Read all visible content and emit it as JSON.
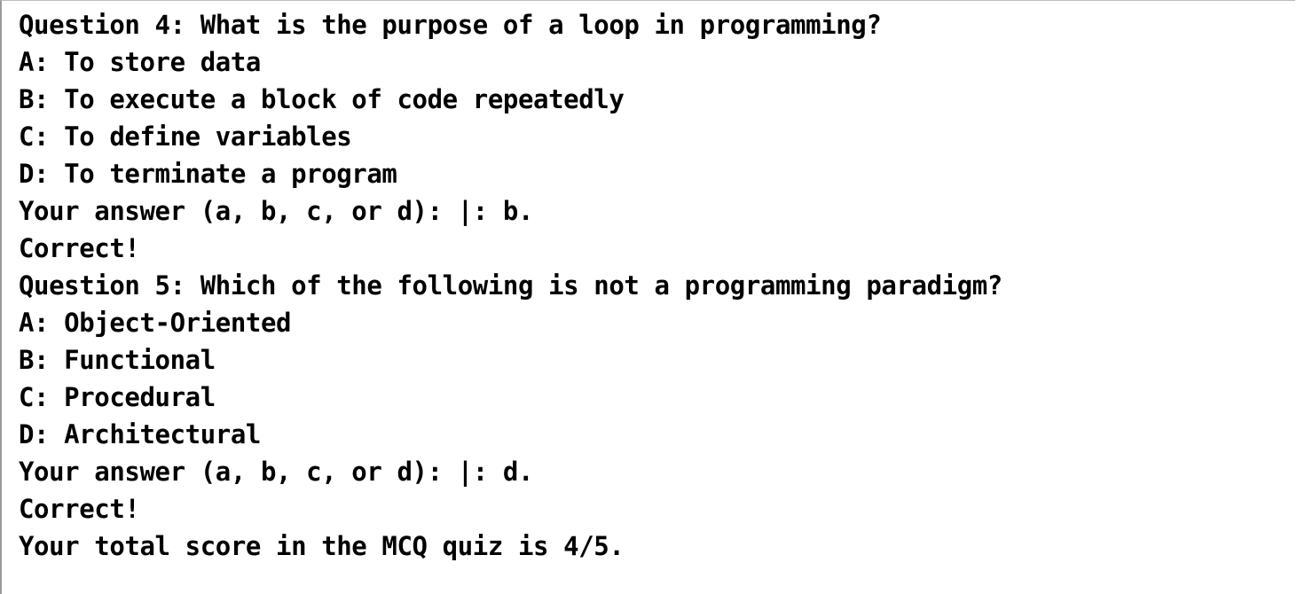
{
  "console": {
    "lines": [
      "Question 4: What is the purpose of a loop in programming?",
      "A: To store data",
      "B: To execute a block of code repeatedly",
      "C: To define variables",
      "D: To terminate a program",
      "Your answer (a, b, c, or d): |: b.",
      "Correct!",
      "Question 5: Which of the following is not a programming paradigm?",
      "A: Object-Oriented",
      "B: Functional",
      "C: Procedural",
      "D: Architectural",
      "Your answer (a, b, c, or d): |: d.",
      "Correct!",
      "Your total score in the MCQ quiz is 4/5."
    ]
  },
  "colors": {
    "background": "#ffffff",
    "text": "#000000",
    "border": "#9a9a9a"
  }
}
